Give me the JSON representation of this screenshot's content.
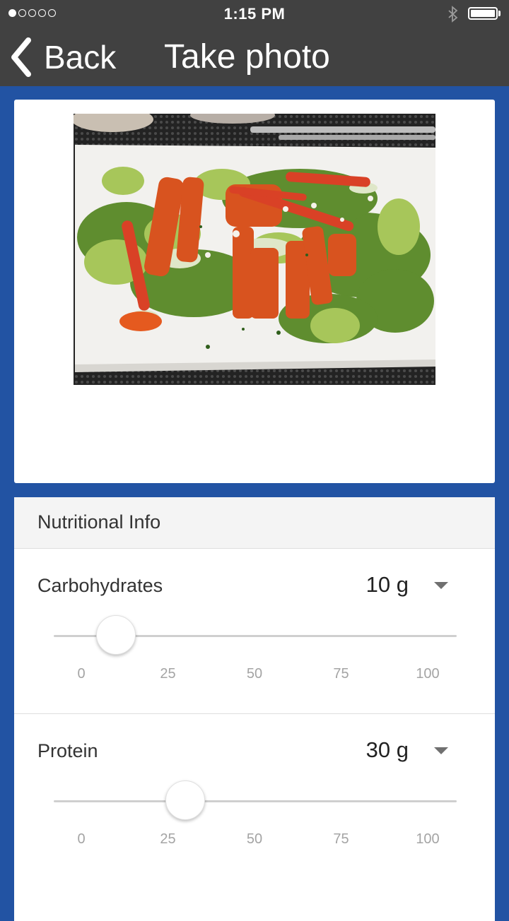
{
  "status_bar": {
    "time": "1:15 PM"
  },
  "nav": {
    "back_label": "Back",
    "title": "Take photo"
  },
  "photo": {
    "alt": "Salad with sliced buffalo chicken and tomato strips on a white plate"
  },
  "nutrition": {
    "header": "Nutritional Info",
    "items": [
      {
        "label": "Carbohydrates",
        "value_text": "10 g",
        "value": 10,
        "ticks": [
          "0",
          "25",
          "50",
          "75",
          "100"
        ]
      },
      {
        "label": "Protein",
        "value_text": "30 g",
        "value": 30,
        "ticks": [
          "0",
          "25",
          "50",
          "75",
          "100"
        ]
      }
    ]
  },
  "colors": {
    "background": "#2253a3",
    "bars": "#414141",
    "card": "#ffffff",
    "header": "#f4f4f4"
  }
}
